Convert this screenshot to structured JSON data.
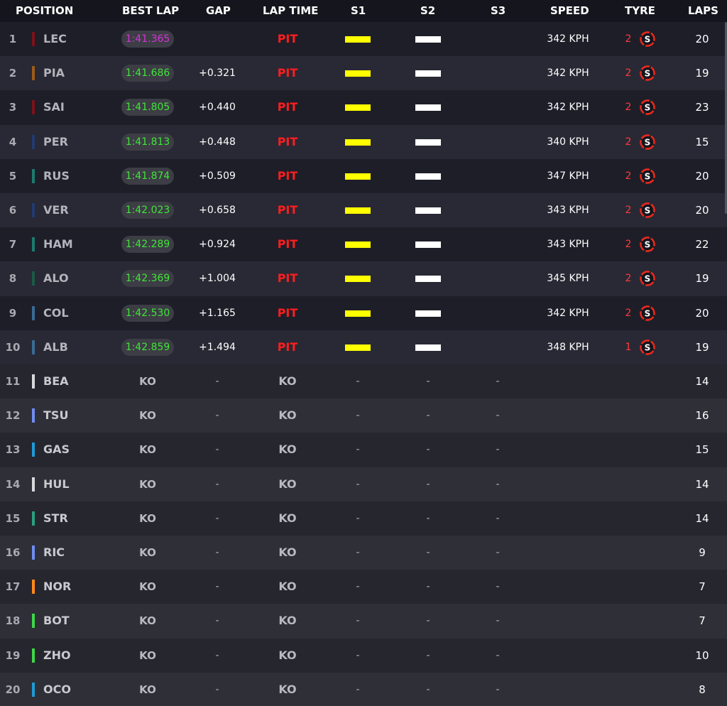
{
  "headers": {
    "position": "POSITION",
    "best_lap": "BEST LAP",
    "gap": "GAP",
    "lap_time": "LAP TIME",
    "s1": "S1",
    "s2": "S2",
    "s3": "S3",
    "speed": "SPEED",
    "tyre": "TYRE",
    "laps": "LAPS"
  },
  "colors": {
    "fastest_lap": "#d633d6",
    "personal_best": "#3ee636",
    "pit": "#ff1e1e",
    "sector_yellow": "#ffff00",
    "sector_white": "#ffffff",
    "soft_tyre": "#e8291c"
  },
  "tyre_compound_letter": "S",
  "rows": [
    {
      "pos": "1",
      "code": "LEC",
      "team_color": "#7a1219",
      "best_lap": "1:41.365",
      "fastest": true,
      "gap": "",
      "lap_time": "PIT",
      "s1": "yellow",
      "s2": "white",
      "s3": "",
      "speed": "342 KPH",
      "tyre_count": "2",
      "laps": "20"
    },
    {
      "pos": "2",
      "code": "PIA",
      "team_color": "#9c5a1a",
      "best_lap": "1:41.686",
      "fastest": false,
      "gap": "+0.321",
      "lap_time": "PIT",
      "s1": "yellow",
      "s2": "white",
      "s3": "",
      "speed": "342 KPH",
      "tyre_count": "2",
      "laps": "19"
    },
    {
      "pos": "3",
      "code": "SAI",
      "team_color": "#7a1219",
      "best_lap": "1:41.805",
      "fastest": false,
      "gap": "+0.440",
      "lap_time": "PIT",
      "s1": "yellow",
      "s2": "white",
      "s3": "",
      "speed": "342 KPH",
      "tyre_count": "2",
      "laps": "23"
    },
    {
      "pos": "4",
      "code": "PER",
      "team_color": "#223a6e",
      "best_lap": "1:41.813",
      "fastest": false,
      "gap": "+0.448",
      "lap_time": "PIT",
      "s1": "yellow",
      "s2": "white",
      "s3": "",
      "speed": "340 KPH",
      "tyre_count": "2",
      "laps": "15"
    },
    {
      "pos": "5",
      "code": "RUS",
      "team_color": "#1c7a6c",
      "best_lap": "1:41.874",
      "fastest": false,
      "gap": "+0.509",
      "lap_time": "PIT",
      "s1": "yellow",
      "s2": "white",
      "s3": "",
      "speed": "347 KPH",
      "tyre_count": "2",
      "laps": "20"
    },
    {
      "pos": "6",
      "code": "VER",
      "team_color": "#223a6e",
      "best_lap": "1:42.023",
      "fastest": false,
      "gap": "+0.658",
      "lap_time": "PIT",
      "s1": "yellow",
      "s2": "white",
      "s3": "",
      "speed": "343 KPH",
      "tyre_count": "2",
      "laps": "20"
    },
    {
      "pos": "7",
      "code": "HAM",
      "team_color": "#1c7a6c",
      "best_lap": "1:42.289",
      "fastest": false,
      "gap": "+0.924",
      "lap_time": "PIT",
      "s1": "yellow",
      "s2": "white",
      "s3": "",
      "speed": "343 KPH",
      "tyre_count": "2",
      "laps": "22"
    },
    {
      "pos": "8",
      "code": "ALO",
      "team_color": "#1a5a44",
      "best_lap": "1:42.369",
      "fastest": false,
      "gap": "+1.004",
      "lap_time": "PIT",
      "s1": "yellow",
      "s2": "white",
      "s3": "",
      "speed": "345 KPH",
      "tyre_count": "2",
      "laps": "19"
    },
    {
      "pos": "9",
      "code": "COL",
      "team_color": "#3a6a94",
      "best_lap": "1:42.530",
      "fastest": false,
      "gap": "+1.165",
      "lap_time": "PIT",
      "s1": "yellow",
      "s2": "white",
      "s3": "",
      "speed": "342 KPH",
      "tyre_count": "2",
      "laps": "20"
    },
    {
      "pos": "10",
      "code": "ALB",
      "team_color": "#3a6a94",
      "best_lap": "1:42.859",
      "fastest": false,
      "gap": "+1.494",
      "lap_time": "PIT",
      "s1": "yellow",
      "s2": "white",
      "s3": "",
      "speed": "348 KPH",
      "tyre_count": "1",
      "laps": "19"
    },
    {
      "pos": "11",
      "code": "BEA",
      "team_color": "#d8d8dc",
      "best_lap": "KO",
      "ko": true,
      "gap": "-",
      "lap_time": "KO",
      "s1": "-",
      "s2": "-",
      "s3": "-",
      "speed": "",
      "tyre_count": "",
      "laps": "14"
    },
    {
      "pos": "12",
      "code": "TSU",
      "team_color": "#6f8cf0",
      "best_lap": "KO",
      "ko": true,
      "gap": "-",
      "lap_time": "KO",
      "s1": "-",
      "s2": "-",
      "s3": "-",
      "speed": "",
      "tyre_count": "",
      "laps": "16"
    },
    {
      "pos": "13",
      "code": "GAS",
      "team_color": "#1e9ad6",
      "best_lap": "KO",
      "ko": true,
      "gap": "-",
      "lap_time": "KO",
      "s1": "-",
      "s2": "-",
      "s3": "-",
      "speed": "",
      "tyre_count": "",
      "laps": "15"
    },
    {
      "pos": "14",
      "code": "HUL",
      "team_color": "#d8d8dc",
      "best_lap": "KO",
      "ko": true,
      "gap": "-",
      "lap_time": "KO",
      "s1": "-",
      "s2": "-",
      "s3": "-",
      "speed": "",
      "tyre_count": "",
      "laps": "14"
    },
    {
      "pos": "15",
      "code": "STR",
      "team_color": "#2aa07e",
      "best_lap": "KO",
      "ko": true,
      "gap": "-",
      "lap_time": "KO",
      "s1": "-",
      "s2": "-",
      "s3": "-",
      "speed": "",
      "tyre_count": "",
      "laps": "14"
    },
    {
      "pos": "16",
      "code": "RIC",
      "team_color": "#6f8cf0",
      "best_lap": "KO",
      "ko": true,
      "gap": "-",
      "lap_time": "KO",
      "s1": "-",
      "s2": "-",
      "s3": "-",
      "speed": "",
      "tyre_count": "",
      "laps": "9"
    },
    {
      "pos": "17",
      "code": "NOR",
      "team_color": "#ff8a1a",
      "best_lap": "KO",
      "ko": true,
      "gap": "-",
      "lap_time": "KO",
      "s1": "-",
      "s2": "-",
      "s3": "-",
      "speed": "",
      "tyre_count": "",
      "laps": "7"
    },
    {
      "pos": "18",
      "code": "BOT",
      "team_color": "#3ed64a",
      "best_lap": "KO",
      "ko": true,
      "gap": "-",
      "lap_time": "KO",
      "s1": "-",
      "s2": "-",
      "s3": "-",
      "speed": "",
      "tyre_count": "",
      "laps": "7"
    },
    {
      "pos": "19",
      "code": "ZHO",
      "team_color": "#3ed64a",
      "best_lap": "KO",
      "ko": true,
      "gap": "-",
      "lap_time": "KO",
      "s1": "-",
      "s2": "-",
      "s3": "-",
      "speed": "",
      "tyre_count": "",
      "laps": "10"
    },
    {
      "pos": "20",
      "code": "OCO",
      "team_color": "#1e9ad6",
      "best_lap": "KO",
      "ko": true,
      "gap": "-",
      "lap_time": "KO",
      "s1": "-",
      "s2": "-",
      "s3": "-",
      "speed": "",
      "tyre_count": "",
      "laps": "8"
    }
  ]
}
